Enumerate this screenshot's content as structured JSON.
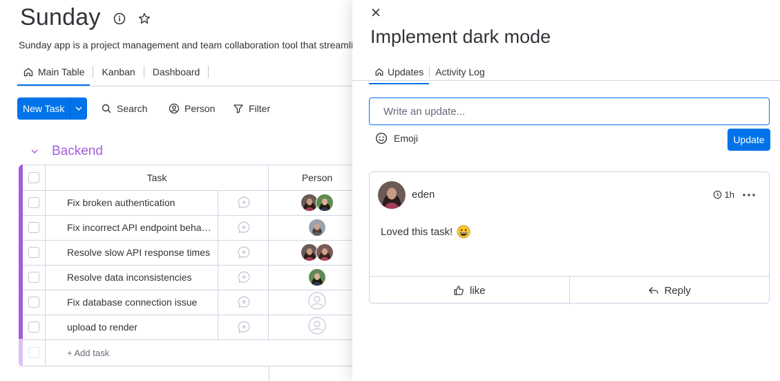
{
  "board": {
    "title": "Sunday",
    "description": "Sunday app is a project management and team collaboration tool that streamlines",
    "views": [
      {
        "label": "Main Table",
        "icon": "home-icon"
      },
      {
        "label": "Kanban"
      },
      {
        "label": "Dashboard"
      }
    ],
    "toolbar": {
      "new_task": "New Task",
      "search": "Search",
      "person": "Person",
      "filter": "Filter"
    },
    "group": {
      "name": "Backend",
      "color": "#a25ddc",
      "columns": {
        "task": "Task",
        "person": "Person"
      },
      "rows": [
        {
          "task": "Fix broken authentication"
        },
        {
          "task": "Fix incorrect API endpoint behavior"
        },
        {
          "task": "Resolve slow API response times"
        },
        {
          "task": "Resolve data inconsistencies"
        },
        {
          "task": "Fix database connection issue"
        },
        {
          "task": "upload to render"
        }
      ],
      "add_task": "+ Add task"
    }
  },
  "panel": {
    "title": "Implement dark mode",
    "tabs": [
      {
        "label": "Updates",
        "icon": "home-icon"
      },
      {
        "label": "Activity Log"
      }
    ],
    "composer": {
      "placeholder": "Write an update...",
      "emoji_label": "Emoji",
      "submit_label": "Update"
    },
    "post": {
      "author": "eden",
      "time": "1h",
      "body": "Loved this task!",
      "emoji": "grinning-face-emoji",
      "like_label": "like",
      "reply_label": "Reply"
    }
  },
  "colors": {
    "accent": "#0073ea",
    "group": "#a25ddc",
    "border": "#d0d4e4",
    "text": "#323338"
  }
}
